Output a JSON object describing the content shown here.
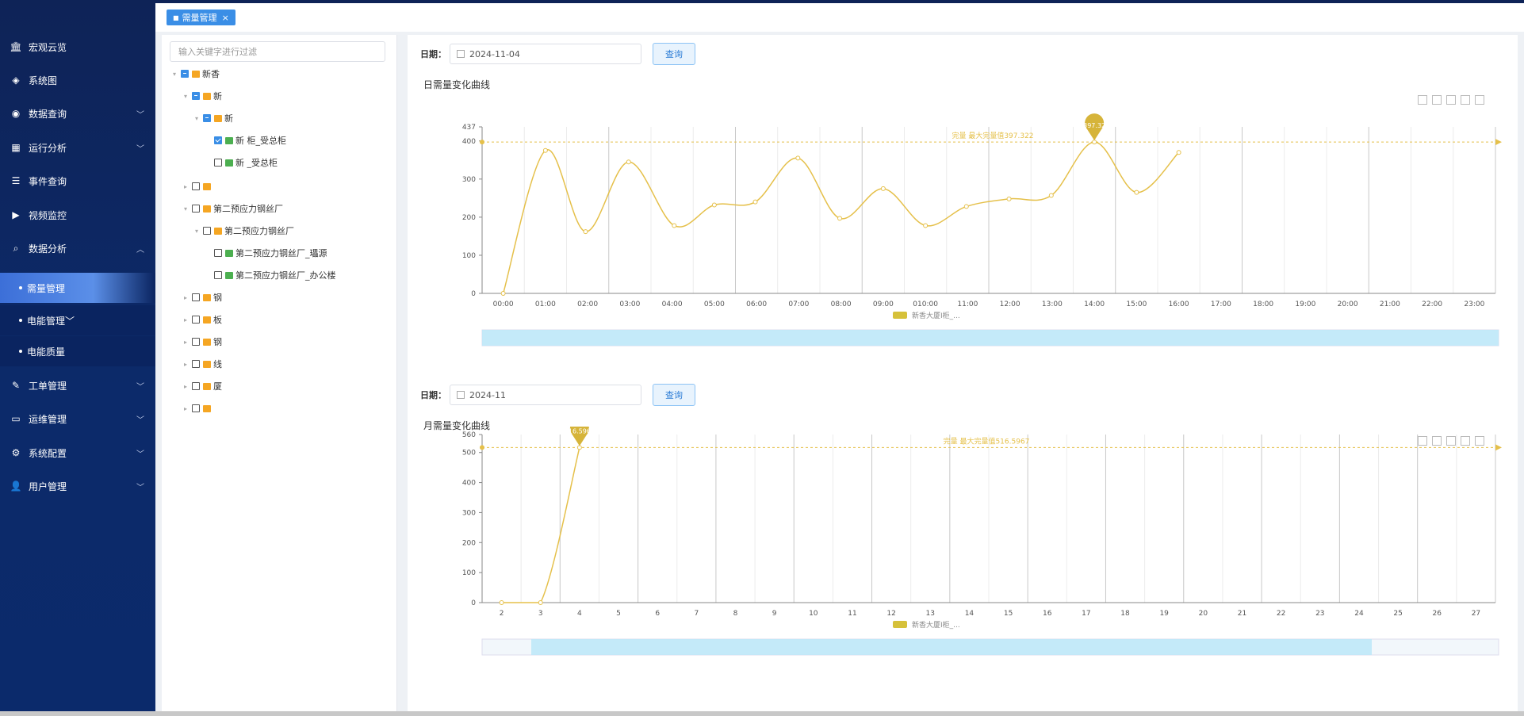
{
  "sidebar": {
    "items": [
      {
        "label": "宏观云览",
        "icon": "bank-icon",
        "chevron": false
      },
      {
        "label": "系统图",
        "icon": "layers-icon",
        "chevron": false
      },
      {
        "label": "数据查询",
        "icon": "eye-icon",
        "chevron": true
      },
      {
        "label": "运行分析",
        "icon": "grid-icon",
        "chevron": true
      },
      {
        "label": "事件查询",
        "icon": "list-icon",
        "chevron": false
      },
      {
        "label": "视频监控",
        "icon": "play-icon",
        "chevron": false
      },
      {
        "label": "数据分析",
        "icon": "search-doc-icon",
        "chevron": true
      },
      {
        "label": "工单管理",
        "icon": "edit-icon",
        "chevron": true
      },
      {
        "label": "运维管理",
        "icon": "monitor-icon",
        "chevron": true
      },
      {
        "label": "系统配置",
        "icon": "gear-icon",
        "chevron": true
      },
      {
        "label": "用户管理",
        "icon": "user-icon",
        "chevron": true
      }
    ],
    "subitems": [
      {
        "label": "需量管理",
        "active": true
      },
      {
        "label": "电能管理",
        "active": false,
        "chevron": true
      },
      {
        "label": "电能质量",
        "active": false
      }
    ]
  },
  "tabs": [
    {
      "label": "需量管理"
    }
  ],
  "tree": {
    "placeholder": "输入关键字进行过滤",
    "nodes": [
      {
        "label": "新香",
        "state": "ind",
        "tri": "▾",
        "icon": "folder"
      },
      {
        "label": "新",
        "state": "ind",
        "tri": "▾",
        "icon": "folder"
      },
      {
        "label": "新",
        "state": "ind",
        "tri": "▾",
        "icon": "folder"
      },
      {
        "label": "新 柜_受总柜",
        "state": "chk",
        "tri": "",
        "icon": "sheet"
      },
      {
        "label": "新 _受总柜",
        "state": "none",
        "tri": "",
        "icon": "sheet"
      },
      {
        "label": "",
        "state": "none",
        "tri": "▸",
        "icon": "folder"
      },
      {
        "label": "第二预应力钢丝厂",
        "state": "none",
        "tri": "▾",
        "icon": "folder"
      },
      {
        "label": "第二预应力钢丝厂",
        "state": "none",
        "tri": "▾",
        "icon": "folder"
      },
      {
        "label": "第二预应力钢丝厂_瓃源",
        "state": "none",
        "tri": "",
        "icon": "sheet"
      },
      {
        "label": "第二预应力钢丝厂_办公楼",
        "state": "none",
        "tri": "",
        "icon": "sheet"
      },
      {
        "label": "钢",
        "state": "none",
        "tri": "▸",
        "icon": "folder"
      },
      {
        "label": "板",
        "state": "none",
        "tri": "▸",
        "icon": "folder"
      },
      {
        "label": "钢",
        "state": "none",
        "tri": "▸",
        "icon": "folder"
      },
      {
        "label": "线",
        "state": "none",
        "tri": "▸",
        "icon": "folder"
      },
      {
        "label": "厦",
        "state": "none",
        "tri": "▸",
        "icon": "folder"
      },
      {
        "label": "",
        "state": "none",
        "tri": "▸",
        "icon": "folder"
      }
    ]
  },
  "filters": [
    {
      "label": "日期：",
      "value": "2024-11-04",
      "button": "查询"
    },
    {
      "label": "日期：",
      "value": "2024-11",
      "button": "查询"
    }
  ],
  "colors": {
    "line": "#e5c04a",
    "sidebar": "#0e2357",
    "accent": "#3a8ee6",
    "zoom": "#bfe8f8"
  },
  "chart_data": [
    {
      "type": "line",
      "title": "日需量变化曲线",
      "legend": "新香大厦I柜_...",
      "categories": [
        "00:00",
        "01:00",
        "02:00",
        "03:00",
        "04:00",
        "05:00",
        "06:00",
        "07:00",
        "08:00",
        "09:00",
        "010:00",
        "11:00",
        "12:00",
        "13:00",
        "14:00",
        "15:00",
        "16:00",
        "17:00",
        "18:00",
        "19:00",
        "20:00",
        "21:00",
        "22:00",
        "23:00"
      ],
      "values": [
        0,
        375,
        162,
        345,
        178,
        232,
        240,
        355,
        197,
        275,
        178,
        228,
        248,
        257,
        397.32,
        265,
        370,
        null,
        null,
        null,
        null,
        null,
        null,
        null
      ],
      "x_points": [
        0.0,
        1.0,
        1.95,
        2.97,
        4.05,
        5.0,
        5.97,
        6.98,
        7.97,
        9.0,
        10.0,
        10.97,
        11.98,
        12.98,
        14.0,
        15.0,
        16.0
      ],
      "ylim": [
        0,
        437
      ],
      "yticks": [
        0,
        100,
        200,
        300,
        400,
        437
      ],
      "markline": {
        "value": 397.322,
        "label": "完量 最大完量值397.322"
      },
      "max_label": "397.32"
    },
    {
      "type": "line",
      "title": "月需量变化曲线",
      "legend": "新香大厦I柜_...",
      "categories": [
        "2",
        "3",
        "4",
        "5",
        "6",
        "7",
        "8",
        "9",
        "10",
        "11",
        "12",
        "13",
        "14",
        "15",
        "16",
        "17",
        "18",
        "19",
        "20",
        "21",
        "22",
        "23",
        "24",
        "25",
        "26",
        "27"
      ],
      "values": [
        0,
        0,
        516.5967,
        null,
        null,
        null,
        null,
        null,
        null,
        null,
        null,
        null,
        null,
        null,
        null,
        null,
        null,
        null,
        null,
        null,
        null,
        null,
        null,
        null,
        null,
        null
      ],
      "ylim": [
        0,
        560
      ],
      "yticks": [
        0,
        100,
        200,
        300,
        400,
        500,
        560
      ],
      "markline": {
        "value": 516.5967,
        "label": "完量 最大完量值516.5967"
      },
      "max_label": "516.5967"
    }
  ]
}
